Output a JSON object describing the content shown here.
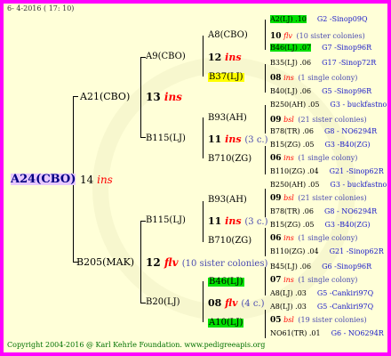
{
  "header": "6- 4-2016 ( 17: 10)",
  "footer": "Copyright 2004-2016 @ Karl Kehrle Foundation.   www.pedigreeapis.org",
  "colors": {
    "frame": "#ff00ff",
    "bg": "#ffffd8",
    "yellow": "#ffff00",
    "green": "#00e000",
    "red": "#ff0000",
    "blue": "#1a1ac8",
    "footer": "#007000"
  },
  "tree": {
    "root": {
      "name": "A24(CBO)",
      "num": "14",
      "tag": "ins"
    },
    "g1": [
      {
        "name": "A21(CBO)",
        "num": "13",
        "tag": "ins"
      },
      {
        "name": "B205(MAK)",
        "num": "12",
        "tag": "flv",
        "note": "(10 sister colonies)"
      }
    ],
    "g2": [
      {
        "name": "A9(CBO)"
      },
      {
        "name": "B115(LJ)",
        "num": "11",
        "tag": "ins",
        "note": "(3 c.)"
      },
      {
        "name": "B115(LJ)",
        "num": "11",
        "tag": "ins",
        "note": "(3 c.)"
      },
      {
        "name": "B20(LJ)",
        "num": "08",
        "tag": "flv",
        "note": "(4 c.)"
      }
    ],
    "g3": [
      {
        "name": "A8(CBO)"
      },
      {
        "name": "12",
        "tag": "ins"
      },
      {
        "name": "B37(LJ)"
      },
      {
        "name": "B93(AH)"
      },
      {
        "name": "B710(ZG)"
      },
      {
        "name": "B93(AH)"
      },
      {
        "name": "B710(ZG)"
      },
      {
        "name": "B46(LJ)"
      },
      {
        "name": "A10(LJ)"
      }
    ],
    "g4": [
      {
        "l": "A2(LJ) .10",
        "r": "G2 -Sinop09Q"
      },
      {
        "l": "10",
        "tag": "flv",
        "r": "(10 sister colonies)"
      },
      {
        "l": "B46(LJ) .07",
        "r": "G7 -Sinop96R"
      },
      {
        "l": "B35(LJ) .06",
        "r": "G17 -Sinop72R"
      },
      {
        "l": "08",
        "tag": "ins",
        "r": "(1 single colony)"
      },
      {
        "l": "B40(LJ) .06",
        "r": "G5 -Sinop96R"
      },
      {
        "l": "B250(AH) .05",
        "r": "G3 - buckfastno"
      },
      {
        "l": "09",
        "tag": "bsl",
        "r": "(21 sister colonies)"
      },
      {
        "l": "B78(TR) .06",
        "r": "G8 - NO6294R"
      },
      {
        "l": "B15(ZG) .05",
        "r": "G3 -B40(ZG)"
      },
      {
        "l": "06",
        "tag": "ins",
        "r": "(1 single colony)"
      },
      {
        "l": "B110(ZG) .04",
        "r": "G21 -Sinop62R"
      },
      {
        "l": "B250(AH) .05",
        "r": "G3 - buckfastno"
      },
      {
        "l": "09",
        "tag": "bsl",
        "r": "(21 sister colonies)"
      },
      {
        "l": "B78(TR) .06",
        "r": "G8 - NO6294R"
      },
      {
        "l": "B15(ZG) .05",
        "r": "G3 -B40(ZG)"
      },
      {
        "l": "06",
        "tag": "ins",
        "r": "(1 single colony)"
      },
      {
        "l": "B110(ZG) .04",
        "r": "G21 -Sinop62R"
      },
      {
        "l": "B45(LJ) .06",
        "r": "G6 -Sinop96R"
      },
      {
        "l": "07",
        "tag": "ins",
        "r": "(1 single colony)"
      },
      {
        "l": "A8(LJ) .03",
        "r": "G5 -Cankiri97Q"
      },
      {
        "l": "A8(LJ) .03",
        "r": "G5 -Cankiri97Q"
      },
      {
        "l": "05",
        "tag": "bsl",
        "r": "(19 sister colonies)"
      },
      {
        "l": "NO61(TR) .01",
        "r": "G6 - NO6294R"
      }
    ]
  }
}
